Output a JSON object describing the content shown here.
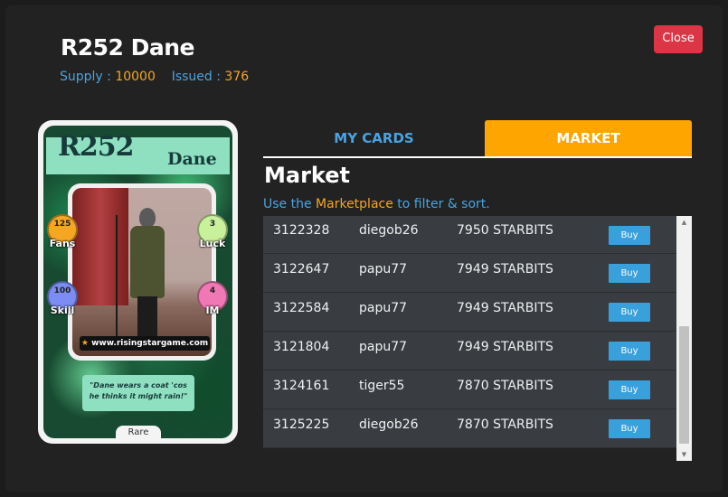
{
  "header": {
    "title": "R252 Dane",
    "supply_label": "Supply :",
    "supply_value": "10000",
    "issued_label": "Issued :",
    "issued_value": "376",
    "close_label": "Close"
  },
  "card": {
    "code": "R252",
    "name": "Dane",
    "stats": {
      "fans": {
        "value": "125",
        "label": "Fans"
      },
      "luck": {
        "value": "3",
        "label": "Luck"
      },
      "skill": {
        "value": "100",
        "label": "Skill"
      },
      "im": {
        "value": "4",
        "label": "IM"
      }
    },
    "website": "www.risingstargame.com",
    "quote": "\"Dane wears a coat 'cos he thinks it might rain!\"",
    "rarity": "Rare"
  },
  "tabs": [
    {
      "label": "MY CARDS",
      "active": false
    },
    {
      "label": "MARKET",
      "active": true
    }
  ],
  "market": {
    "heading": "Market",
    "sub_prefix": "Use the",
    "sub_link": "Marketplace",
    "sub_suffix": "to filter & sort.",
    "buy_label": "Buy",
    "listings": [
      {
        "id": "3122328",
        "seller": "diegob26",
        "price": "7950 STARBITS"
      },
      {
        "id": "3122647",
        "seller": "papu77",
        "price": "7949 STARBITS"
      },
      {
        "id": "3122584",
        "seller": "papu77",
        "price": "7949 STARBITS"
      },
      {
        "id": "3121804",
        "seller": "papu77",
        "price": "7949 STARBITS"
      },
      {
        "id": "3124161",
        "seller": "tiger55",
        "price": "7870 STARBITS"
      },
      {
        "id": "3125225",
        "seller": "diegob26",
        "price": "7870 STARBITS"
      }
    ]
  },
  "colors": {
    "background": "#222222",
    "accent_blue": "#4aa3e0",
    "accent_orange": "#ffa500",
    "close_red": "#dc3545",
    "row_bg": "#393d42",
    "buy_blue": "#3aa0db"
  }
}
